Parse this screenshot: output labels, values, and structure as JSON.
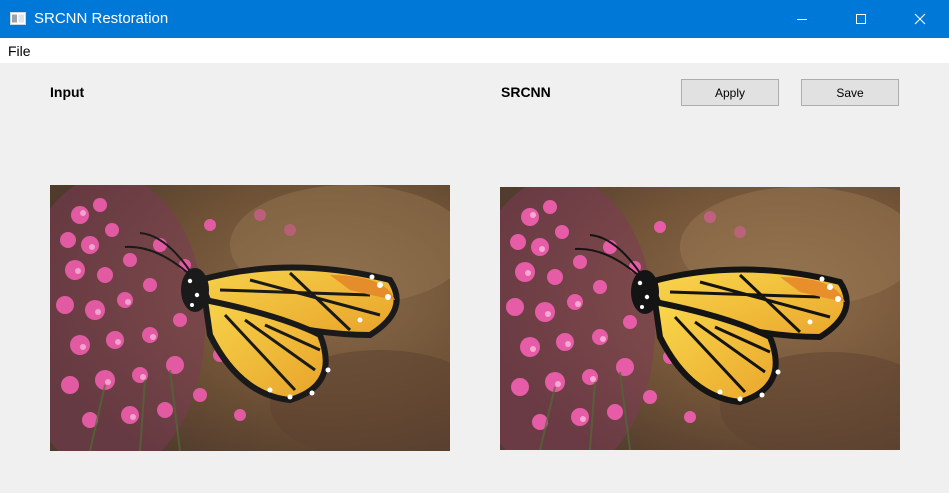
{
  "window": {
    "title": "SRCNN Restoration"
  },
  "titlebar_controls": {
    "minimize_icon": "minimize-icon",
    "maximize_icon": "maximize-icon",
    "close_icon": "close-icon"
  },
  "menu": {
    "file_label": "File"
  },
  "panels": {
    "input_label": "Input",
    "output_label": "SRCNN"
  },
  "toolbar": {
    "apply_label": "Apply",
    "save_label": "Save"
  },
  "colors": {
    "titlebar": "#0078d7",
    "window_bg": "#f0f0f0",
    "button_bg": "#e1e1e1",
    "button_border": "#adadad"
  }
}
